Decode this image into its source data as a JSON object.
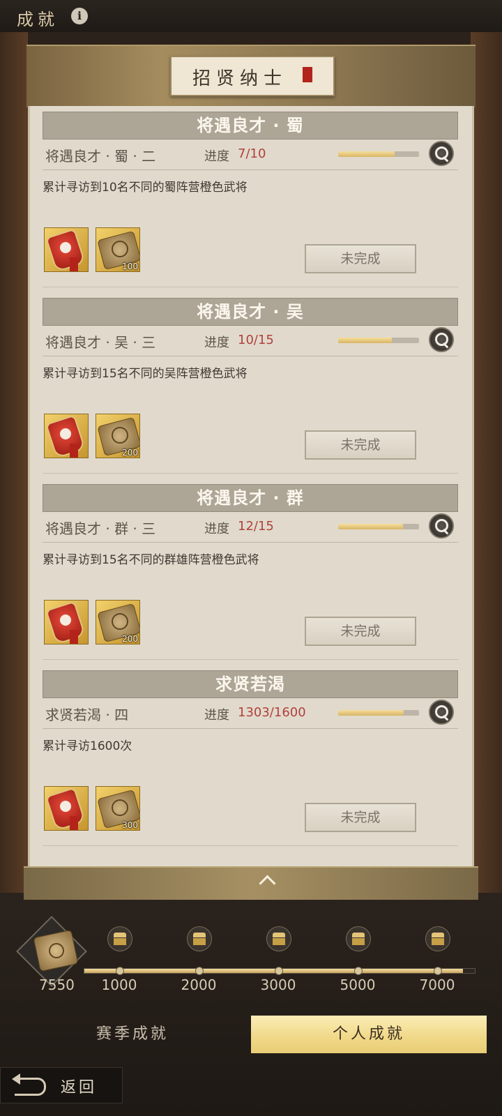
{
  "header": {
    "title": "成就",
    "info_icon": "info-icon"
  },
  "banner": {
    "title": "招贤纳士",
    "seal_icon": "red-seal-icon"
  },
  "cards": [
    {
      "heading": "将遇良才 · 蜀",
      "subtitle": "将遇良才 · 蜀 · 二",
      "progress_label": "进度",
      "progress_value": "7/10",
      "progress": 0.7,
      "description": "累计寻访到10名不同的蜀阵营橙色武将",
      "rewards": [
        {
          "icon": "token-icon",
          "count": ""
        },
        {
          "icon": "scroll-icon",
          "count": "100"
        }
      ],
      "status": "未完成"
    },
    {
      "heading": "将遇良才 · 吴",
      "subtitle": "将遇良才 · 吴 · 三",
      "progress_label": "进度",
      "progress_value": "10/15",
      "progress": 0.667,
      "description": "累计寻访到15名不同的吴阵营橙色武将",
      "rewards": [
        {
          "icon": "token-icon",
          "count": ""
        },
        {
          "icon": "scroll-icon",
          "count": "200"
        }
      ],
      "status": "未完成"
    },
    {
      "heading": "将遇良才 · 群",
      "subtitle": "将遇良才 · 群 · 三",
      "progress_label": "进度",
      "progress_value": "12/15",
      "progress": 0.8,
      "description": "累计寻访到15名不同的群雄阵营橙色武将",
      "rewards": [
        {
          "icon": "token-icon",
          "count": ""
        },
        {
          "icon": "scroll-icon",
          "count": "200"
        }
      ],
      "status": "未完成"
    },
    {
      "heading": "求贤若渴",
      "subtitle": "求贤若渴 · 四",
      "progress_label": "进度",
      "progress_value": "1303/1600",
      "progress": 0.814,
      "description": "累计寻访1600次",
      "rewards": [
        {
          "icon": "token-icon",
          "count": ""
        },
        {
          "icon": "scroll-icon",
          "count": "300"
        }
      ],
      "status": "未完成"
    }
  ],
  "collapse_icon": "chevron-up-icon",
  "milestones": {
    "score": "7550",
    "score_icon": "scroll-icon",
    "fill": 0.97,
    "points": [
      {
        "label": "1000",
        "icon": "chest-icon"
      },
      {
        "label": "2000",
        "icon": "chest-icon"
      },
      {
        "label": "3000",
        "icon": "chest-icon"
      },
      {
        "label": "5000",
        "icon": "chest-icon"
      },
      {
        "label": "7000",
        "icon": "chest-icon"
      }
    ]
  },
  "tabs": {
    "season": "赛季成就",
    "personal": "个人成就"
  },
  "footer": {
    "back": "返回",
    "back_icon": "back-arrow-icon"
  },
  "colors": {
    "accent_gold": "#f0d887",
    "progress_red": "#b0413c",
    "panel": "#e1dacc"
  }
}
